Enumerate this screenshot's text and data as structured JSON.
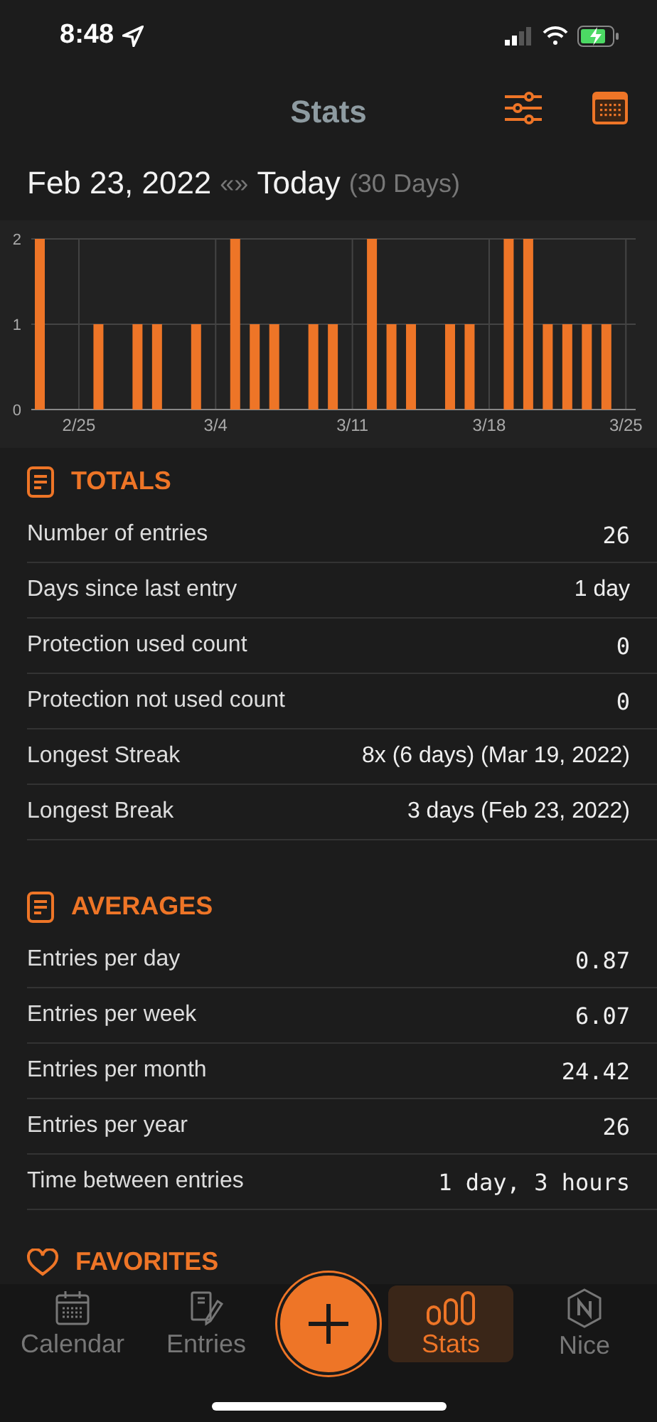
{
  "status_bar": {
    "time": "8:48"
  },
  "header": {
    "title": "Stats"
  },
  "range": {
    "start": "Feb 23, 2022",
    "arrows": "«»",
    "end": "Today",
    "days": "(30 Days)"
  },
  "chart_data": {
    "type": "bar",
    "categories": [
      null,
      null,
      "2/25",
      null,
      null,
      null,
      null,
      null,
      null,
      "3/4",
      null,
      null,
      null,
      null,
      null,
      null,
      "3/11",
      null,
      null,
      null,
      null,
      null,
      null,
      "3/18",
      null,
      null,
      null,
      null,
      null,
      null,
      "3/25"
    ],
    "grid": true,
    "values": [
      2,
      0,
      0,
      1,
      0,
      1,
      1,
      0,
      1,
      0,
      2,
      1,
      1,
      0,
      1,
      1,
      0,
      2,
      1,
      1,
      0,
      1,
      1,
      0,
      2,
      2,
      1,
      1,
      1,
      1,
      0
    ],
    "ylim": [
      0,
      2
    ],
    "yticks": [
      0,
      1,
      2
    ]
  },
  "sections": [
    {
      "title": "TOTALS",
      "rows": [
        {
          "label": "Number of entries",
          "value": "26",
          "kind": "mono"
        },
        {
          "label": "Days since last entry",
          "value": "1 day",
          "kind": "text"
        },
        {
          "label": "Protection used count",
          "value": "0",
          "kind": "mono"
        },
        {
          "label": "Protection not used count",
          "value": "0",
          "kind": "mono"
        },
        {
          "label": "Longest Streak",
          "value": "8x (6 days) (Mar 19, 2022)",
          "kind": "text"
        },
        {
          "label": "Longest Break",
          "value": "3 days (Feb 23, 2022)",
          "kind": "text"
        }
      ]
    },
    {
      "title": "AVERAGES",
      "rows": [
        {
          "label": "Entries per day",
          "value": "0.87",
          "kind": "mono"
        },
        {
          "label": "Entries per week",
          "value": "6.07",
          "kind": "mono"
        },
        {
          "label": "Entries per month",
          "value": "24.42",
          "kind": "mono"
        },
        {
          "label": "Entries per year",
          "value": "26",
          "kind": "mono"
        },
        {
          "label": "Time between entries",
          "value": "1 day, 3 hours",
          "kind": "mono"
        }
      ]
    }
  ],
  "favorites": {
    "title": "FAVORITES"
  },
  "tab_bar": [
    {
      "label": "Calendar",
      "kind": "calendar",
      "selected": false
    },
    {
      "label": "Entries",
      "kind": "entries",
      "selected": false
    },
    {
      "kind": "add",
      "selected": false
    },
    {
      "label": "Stats",
      "kind": "stats",
      "selected": true
    },
    {
      "label": "Nice",
      "kind": "nice",
      "selected": false
    }
  ]
}
